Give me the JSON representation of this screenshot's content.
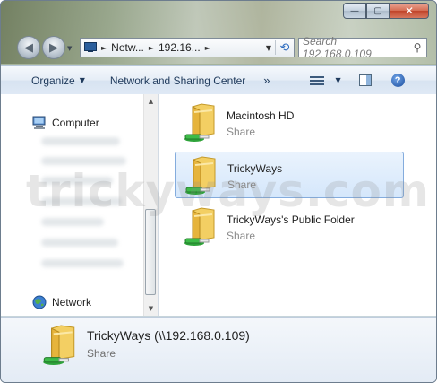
{
  "window": {
    "caption_minimize": "—",
    "caption_maximize": "▢",
    "caption_close": "✕"
  },
  "address": {
    "segments": [
      "Netw...",
      "192.16..."
    ],
    "separator": "►"
  },
  "search": {
    "placeholder": "Search 192.168.0.109"
  },
  "toolbar": {
    "organize": "Organize",
    "network_sharing_center": "Network and Sharing Center",
    "more": "»"
  },
  "navpane": {
    "computer": "Computer",
    "network": "Network"
  },
  "items": [
    {
      "name": "Macintosh HD",
      "type": "Share",
      "selected": false
    },
    {
      "name": "TrickyWays",
      "type": "Share",
      "selected": true
    },
    {
      "name": "TrickyWays's Public Folder",
      "type": "Share",
      "selected": false
    }
  ],
  "details": {
    "name": "TrickyWays (\\\\192.168.0.109)",
    "type": "Share"
  },
  "watermark": "trickyways.com",
  "colors": {
    "selection_border": "#84acdd",
    "selection_fill": "#d5e7fb",
    "toolbar_text": "#1e395b",
    "folder_yellow": "#f0c34d",
    "network_green": "#2ea33a"
  }
}
